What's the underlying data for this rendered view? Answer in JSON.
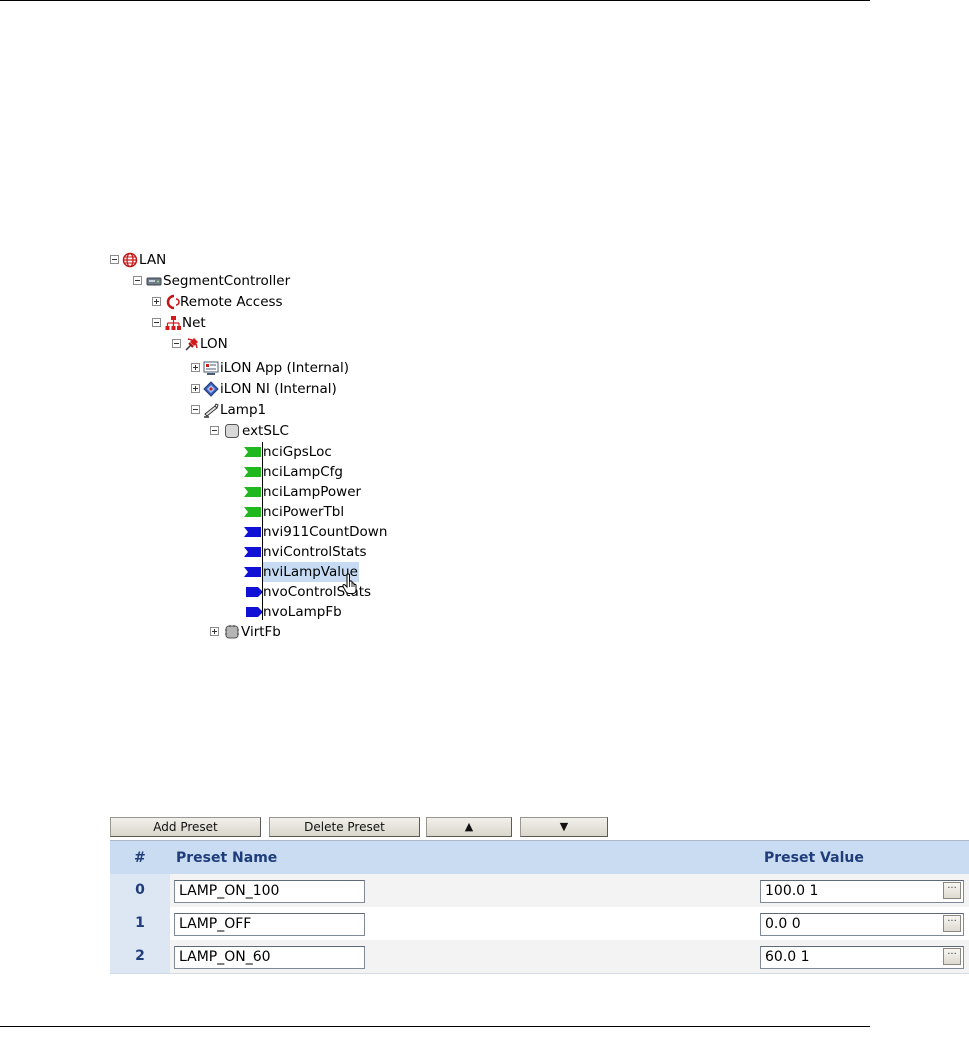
{
  "tree": {
    "nodes": [
      {
        "label": "LAN",
        "icon": "globe-icon",
        "expander": "minus"
      },
      {
        "label": "SegmentController",
        "icon": "controller-icon",
        "expander": "minus"
      },
      {
        "label": "Remote Access",
        "icon": "remote-access-icon",
        "expander": "plus"
      },
      {
        "label": "Net",
        "icon": "network-icon",
        "expander": "minus"
      },
      {
        "label": "LON",
        "icon": "lon-plug-icon",
        "expander": "minus"
      },
      {
        "label": "iLON App (Internal)",
        "icon": "app-icon",
        "expander": "plus"
      },
      {
        "label": "iLON NI (Internal)",
        "icon": "ni-icon",
        "expander": "plus"
      },
      {
        "label": "Lamp1",
        "icon": "device-icon",
        "expander": "minus"
      },
      {
        "label": "extSLC",
        "icon": "functional-block-icon",
        "expander": "minus"
      },
      {
        "label": "nciGpsLoc",
        "icon": "green-datapoint-icon"
      },
      {
        "label": "nciLampCfg",
        "icon": "green-datapoint-icon"
      },
      {
        "label": "nciLampPower",
        "icon": "green-datapoint-icon"
      },
      {
        "label": "nciPowerTbl",
        "icon": "green-datapoint-icon"
      },
      {
        "label": "nvi911CountDown",
        "icon": "blue-input-datapoint-icon"
      },
      {
        "label": "nviControlStats",
        "icon": "blue-input-datapoint-icon"
      },
      {
        "label": "nviLampValue",
        "icon": "blue-input-datapoint-icon",
        "selected": true
      },
      {
        "label": "nvoControlStats",
        "icon": "blue-output-datapoint-icon"
      },
      {
        "label": "nvoLampFb",
        "icon": "blue-output-datapoint-icon"
      },
      {
        "label": "VirtFb",
        "icon": "virtual-block-icon",
        "expander": "plus"
      }
    ]
  },
  "presets": {
    "toolbar": {
      "add_label": "Add Preset",
      "delete_label": "Delete Preset",
      "up_label": "▲",
      "down_label": "▼"
    },
    "columns": {
      "num": "#",
      "name": "Preset Name",
      "value": "Preset Value"
    },
    "rows": [
      {
        "num": "0",
        "name": "LAMP_ON_100",
        "value": "100.0 1"
      },
      {
        "num": "1",
        "name": "LAMP_OFF",
        "value": "0.0 0"
      },
      {
        "num": "2",
        "name": "LAMP_ON_60",
        "value": "60.0 1"
      }
    ],
    "ellipsis": "···"
  }
}
